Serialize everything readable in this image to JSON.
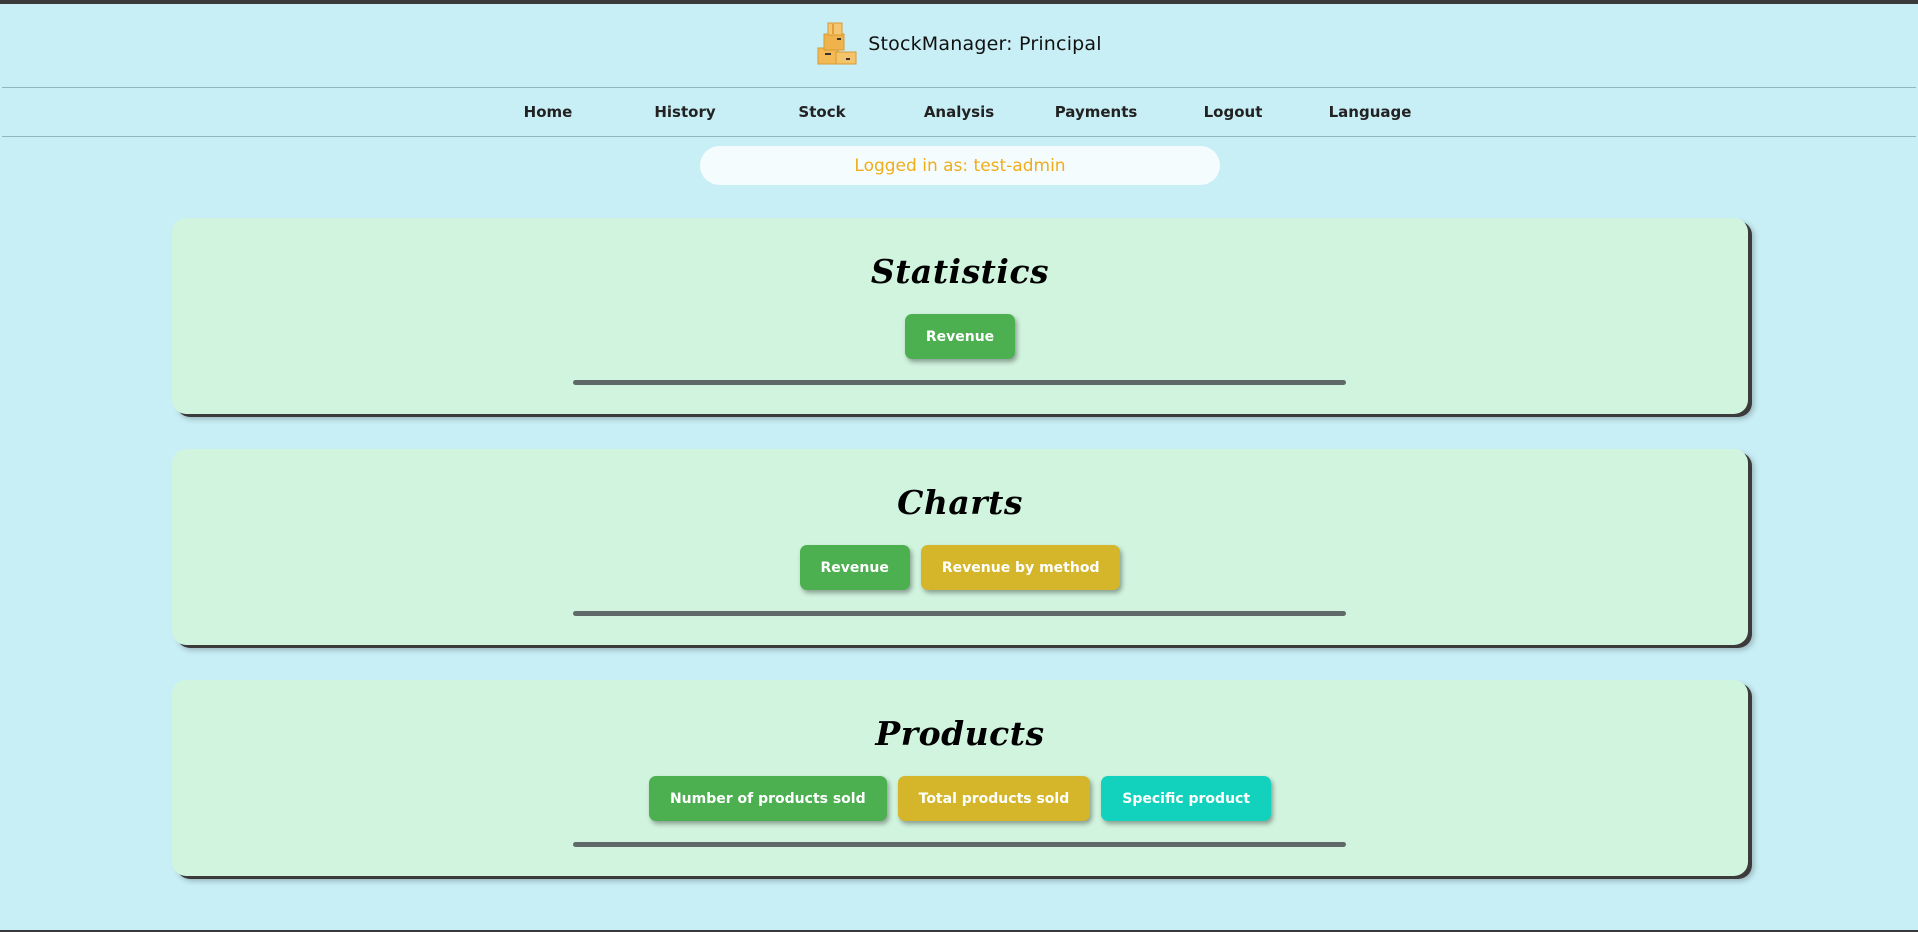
{
  "header": {
    "title": "StockManager: Principal",
    "logo_icon": "boxes-icon"
  },
  "nav": {
    "items": [
      {
        "label": "Home"
      },
      {
        "label": "History"
      },
      {
        "label": "Stock"
      },
      {
        "label": "Analysis"
      },
      {
        "label": "Payments"
      },
      {
        "label": "Logout"
      },
      {
        "label": "Language"
      }
    ]
  },
  "login": {
    "text": "Logged in as: test-admin"
  },
  "sections": [
    {
      "title": "Statistics",
      "buttons": [
        {
          "label": "Revenue",
          "color": "#4caf50"
        }
      ]
    },
    {
      "title": "Charts",
      "buttons": [
        {
          "label": "Revenue",
          "color": "#4caf50"
        },
        {
          "label": "Revenue by method",
          "color": "#d5b62a"
        }
      ]
    },
    {
      "title": "Products",
      "buttons": [
        {
          "label": "Number of products sold",
          "color": "#4caf50"
        },
        {
          "label": "Total products sold",
          "color": "#d5b62a"
        },
        {
          "label": "Specific product",
          "color": "#13d2bd"
        }
      ]
    }
  ],
  "colors": {
    "background": "#c8eff6",
    "card": "#d1f4de",
    "login_text": "#f0ad1a",
    "accent_green": "#4caf50",
    "accent_yellow": "#d5b62a",
    "accent_teal": "#13d2bd"
  }
}
